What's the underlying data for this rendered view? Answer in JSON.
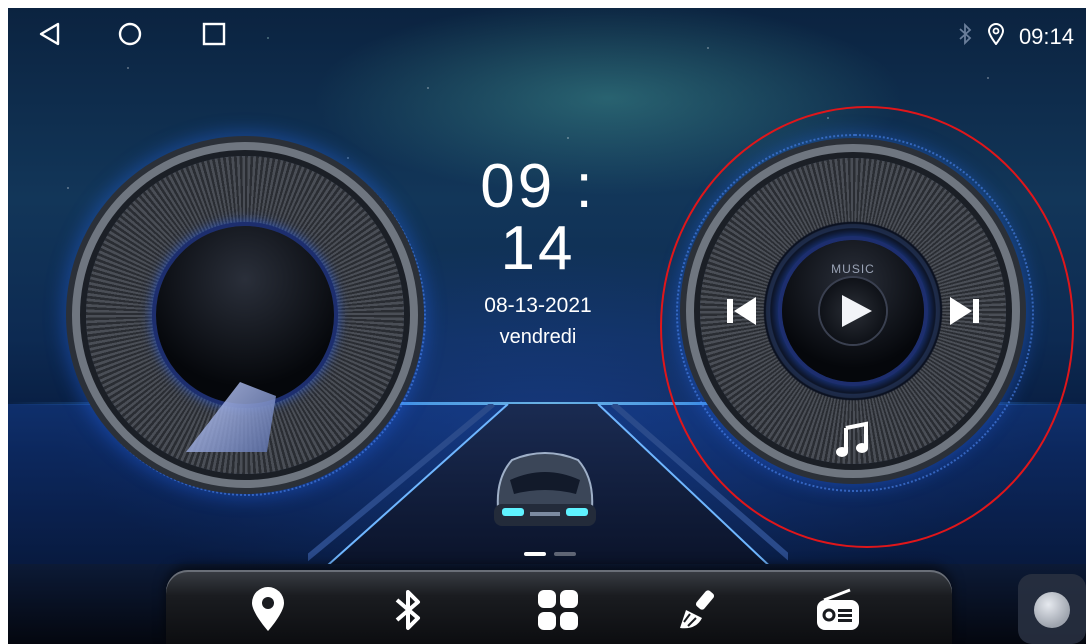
{
  "navbar": {
    "back_icon": "back-triangle-icon",
    "home_icon": "home-circle-icon",
    "recents_icon": "recents-square-icon"
  },
  "status_bar": {
    "bluetooth_icon": "bluetooth-icon",
    "location_icon": "location-pin-icon",
    "time": "09:14"
  },
  "clock_widget": {
    "time": "09 : 14",
    "date": "08-13-2021",
    "day": "vendredi"
  },
  "music_widget": {
    "label": "MUSIC",
    "icons": [
      "previous-track-icon",
      "play-icon",
      "next-track-icon",
      "music-note-icon"
    ]
  },
  "dock": {
    "items": [
      {
        "name": "navigation",
        "icon": "map-pin-icon"
      },
      {
        "name": "bluetooth",
        "icon": "bluetooth-icon"
      },
      {
        "name": "apps",
        "icon": "app-grid-icon"
      },
      {
        "name": "theme",
        "icon": "paint-brush-icon"
      },
      {
        "name": "radio",
        "icon": "radio-icon"
      }
    ]
  },
  "colors": {
    "annotation": "#e0161a",
    "accent_blue": "#3d9dff",
    "text": "#ffffff"
  }
}
